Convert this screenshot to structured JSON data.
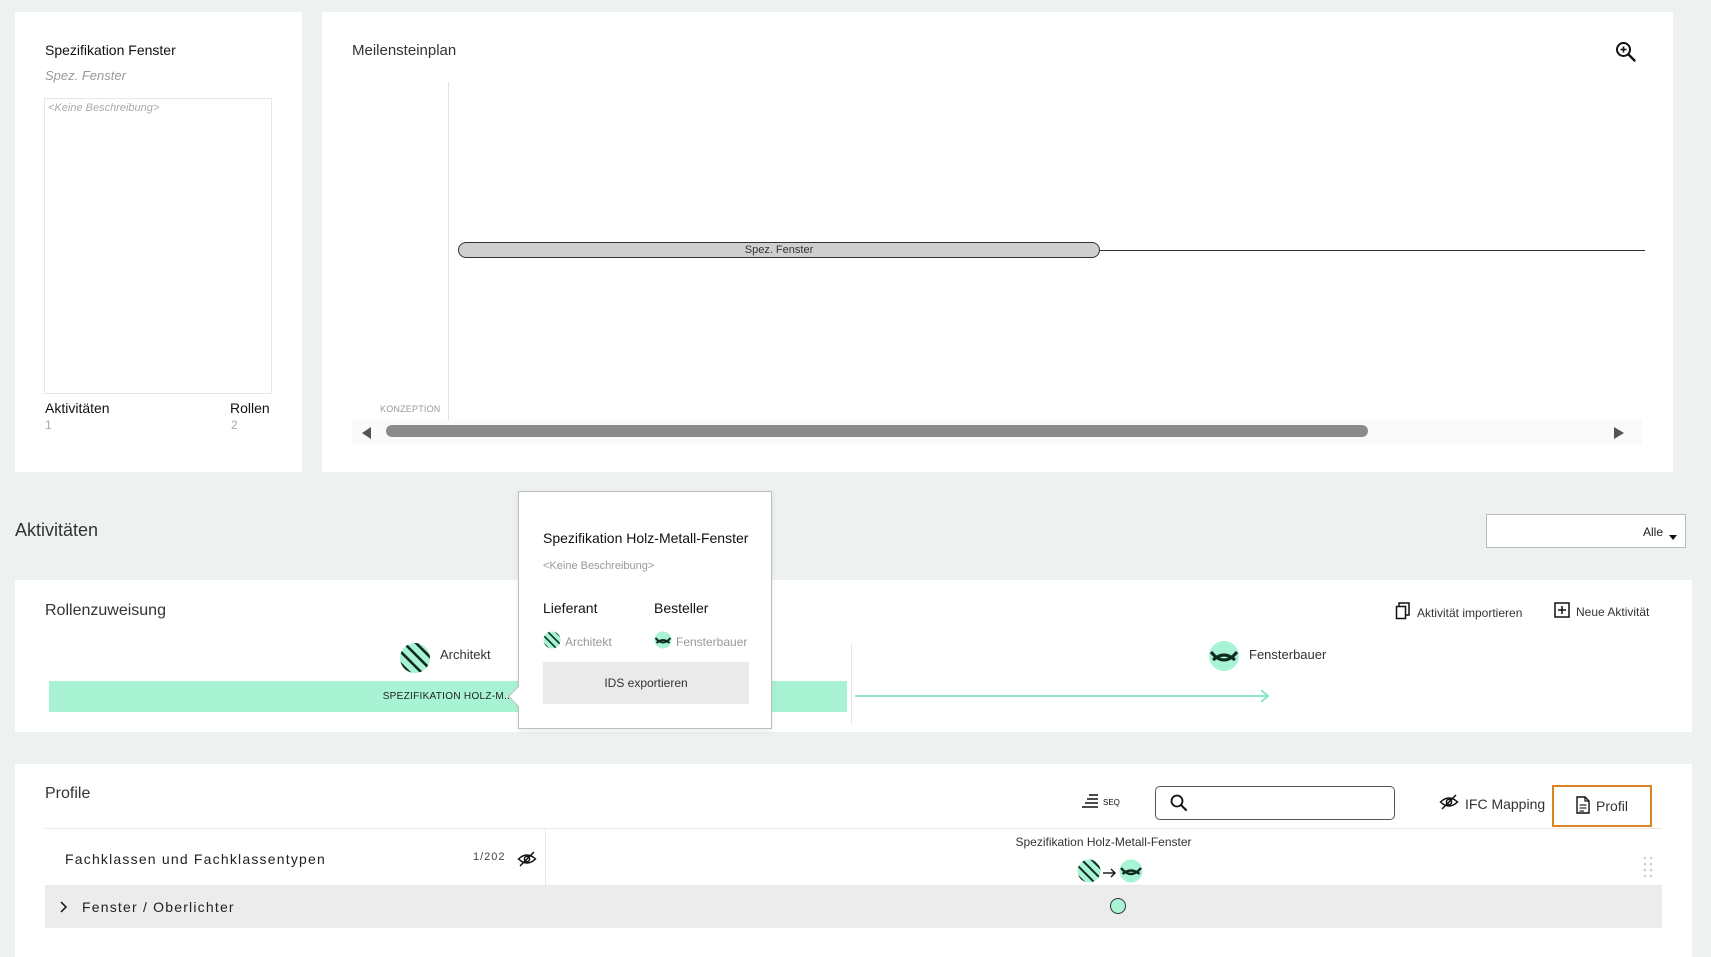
{
  "info_card": {
    "title": "Spezifikation Fenster",
    "subtitle": "Spez. Fenster",
    "description": "<Keine Beschreibung>",
    "activities_label": "Aktivitäten",
    "activities_count": "1",
    "roles_label": "Rollen",
    "roles_count": "2"
  },
  "milestone": {
    "title": "Meilensteinplan",
    "bar_label": "Spez. Fenster",
    "phase_label": "KONZEPTION",
    "zoom_icon": "zoom-in-icon"
  },
  "activities_section": {
    "heading": "Aktivitäten",
    "filter_value": "Alle"
  },
  "roles": {
    "title": "Rollenzuweisung",
    "import_label": "Aktivität importieren",
    "new_label": "Neue Aktivität",
    "architect_label": "Architekt",
    "window_builder_label": "Fensterbauer",
    "timeline_label": "SPEZIFIKATION HOLZ-M..."
  },
  "popover": {
    "title": "Spezifikation Holz-Metall-Fenster",
    "description": "<Keine Beschreibung>",
    "supplier_label": "Lieferant",
    "orderer_label": "Besteller",
    "supplier_role": "Architekt",
    "orderer_role": "Fensterbauer",
    "export_label": "IDS exportieren"
  },
  "profile": {
    "title": "Profile",
    "seq_label": "SEQ",
    "search_placeholder": "",
    "ifc_mapping_label": "IFC Mapping",
    "profil_label": "Profil",
    "col1_header": "Fachklassen und Fachklassentypen",
    "col1_count": "1/202",
    "col2_header": "Spezifikation Holz-Metall-Fenster",
    "rows": [
      {
        "label": "Fenster / Oberlichter"
      }
    ]
  },
  "colors": {
    "background": "#edf2f1",
    "accent_green": "#a8f3d4",
    "highlight_orange": "#d98522",
    "scroll_thumb": "#8b8b8b"
  }
}
